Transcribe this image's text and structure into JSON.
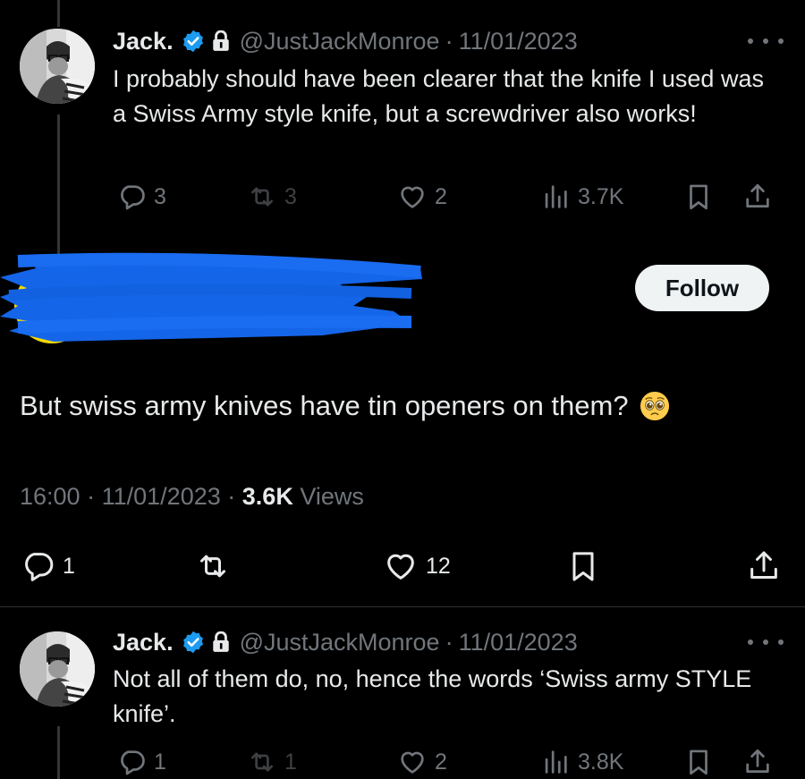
{
  "tweet1": {
    "name": "Jack.",
    "handle": "@JustJackMonroe",
    "separator": "·",
    "date": "11/01/2023",
    "text": "I probably should have been clearer that the knife I used was a Swiss Army style knife, but a screwdriver also works!",
    "replies": "3",
    "retweets": "3",
    "likes": "2",
    "views": "3.7K"
  },
  "main_tweet": {
    "follow_label": "Follow",
    "text": "But swiss army knives have tin openers on them?",
    "emoji": "pleading-face",
    "time": "16:00",
    "separator": "·",
    "date": "11/01/2023",
    "views_count": "3.6K",
    "views_label": "Views",
    "replies": "1",
    "likes": "12"
  },
  "tweet2": {
    "name": "Jack.",
    "handle": "@JustJackMonroe",
    "separator": "·",
    "date": "11/01/2023",
    "text": "Not all of them do, no, hence the words ‘Swiss army STYLE knife’.",
    "replies": "1",
    "retweets": "1",
    "likes": "2",
    "views": "3.8K"
  },
  "colors": {
    "background": "#000000",
    "text": "#e7e9ea",
    "secondary": "#71767b",
    "verified": "#1d9bf0",
    "redaction": "#1565e8",
    "avatar_yellow": "#f5d90a"
  }
}
